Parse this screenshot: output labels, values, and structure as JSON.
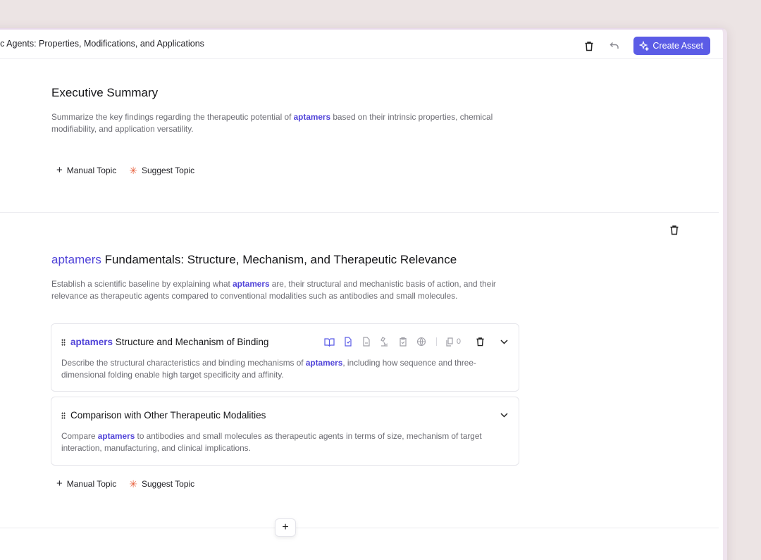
{
  "header": {
    "title": "eutic Agents: Properties, Modifications, and Applications",
    "create_label": "Create Asset"
  },
  "sections": [
    {
      "title": "Executive Summary",
      "desc_pre": "Summarize the key findings regarding the therapeutic potential of ",
      "desc_hl": "aptamers",
      "desc_post": " based on their intrinsic properties, chemical modifiability, and application versatility.",
      "manual_label": "Manual Topic",
      "suggest_label": "Suggest Topic"
    },
    {
      "title_hl": "aptamers",
      "title_rest": " Fundamentals: Structure, Mechanism, and Therapeutic Relevance",
      "desc_pre": "Establish a scientific baseline by explaining what ",
      "desc_hl": "aptamers",
      "desc_post": " are, their structural and mechanistic basis of action, and their relevance as therapeutic agents compared to conventional modalities such as antibodies and small molecules.",
      "manual_label": "Manual Topic",
      "suggest_label": "Suggest Topic",
      "topics": [
        {
          "title_hl": "aptamers",
          "title_rest": " Structure and Mechanism of Binding",
          "desc_pre": "Describe the structural characteristics and binding mechanisms of ",
          "desc_hl": "aptamers",
          "desc_post": ", including how sequence and three-dimensional folding enable high target specificity and affinity.",
          "count": "0"
        },
        {
          "title": "Comparison with Other Therapeutic Modalities",
          "desc_pre": "Compare ",
          "desc_hl": "aptamers",
          "desc_post": " to antibodies and small molecules as therapeutic agents in terms of size, mechanism of target interaction, manufacturing, and clinical implications."
        }
      ]
    }
  ],
  "colors": {
    "accent": "#5b5ce6",
    "highlight": "#5043d8",
    "suggest": "#e8603c"
  },
  "icons": [
    "trash-icon",
    "undo-icon",
    "sparkle-icon",
    "book-icon",
    "document-icon",
    "file-icon",
    "microscope-icon",
    "clipboard-icon",
    "globe-icon",
    "copy-icon",
    "chevron-down-icon",
    "drag-handle-icon",
    "plus-icon"
  ]
}
